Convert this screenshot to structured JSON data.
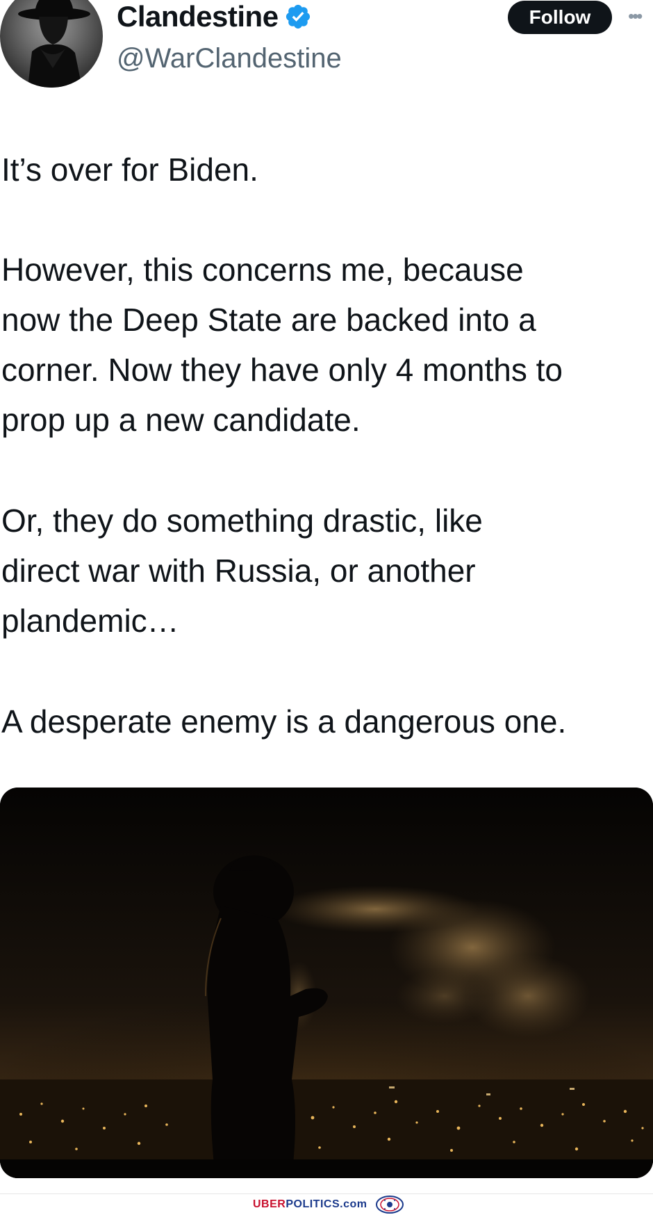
{
  "tweet": {
    "display_name": "Clandestine",
    "handle": "@WarClandestine",
    "verified_icon": "verified-badge-icon",
    "follow_label": "Follow",
    "more_icon": "more-options-icon",
    "paragraphs": {
      "p1": [
        "It’s over for Biden."
      ],
      "p2": [
        "However, this concerns me, because",
        "now the Deep State are backed into a",
        "corner. Now they have only 4 months to",
        "prop up a new candidate."
      ],
      "p3": [
        "Or, they do something drastic, like",
        "direct war with Russia, or another",
        "plandemic…"
      ],
      "p4": [
        "A desperate enemy is a dangerous one."
      ]
    },
    "media_description": "night-city-skyline-with-frog-silhouette-exhaling-smoke"
  },
  "watermark": {
    "part1": "UBER",
    "part2": "POLITICS.com"
  },
  "colors": {
    "text_primary": "#0f1419",
    "text_secondary": "#536471",
    "verified_blue": "#1d9bf0",
    "button_bg": "#0f1419",
    "watermark_red": "#c8102e",
    "watermark_blue": "#1b3a8c"
  }
}
